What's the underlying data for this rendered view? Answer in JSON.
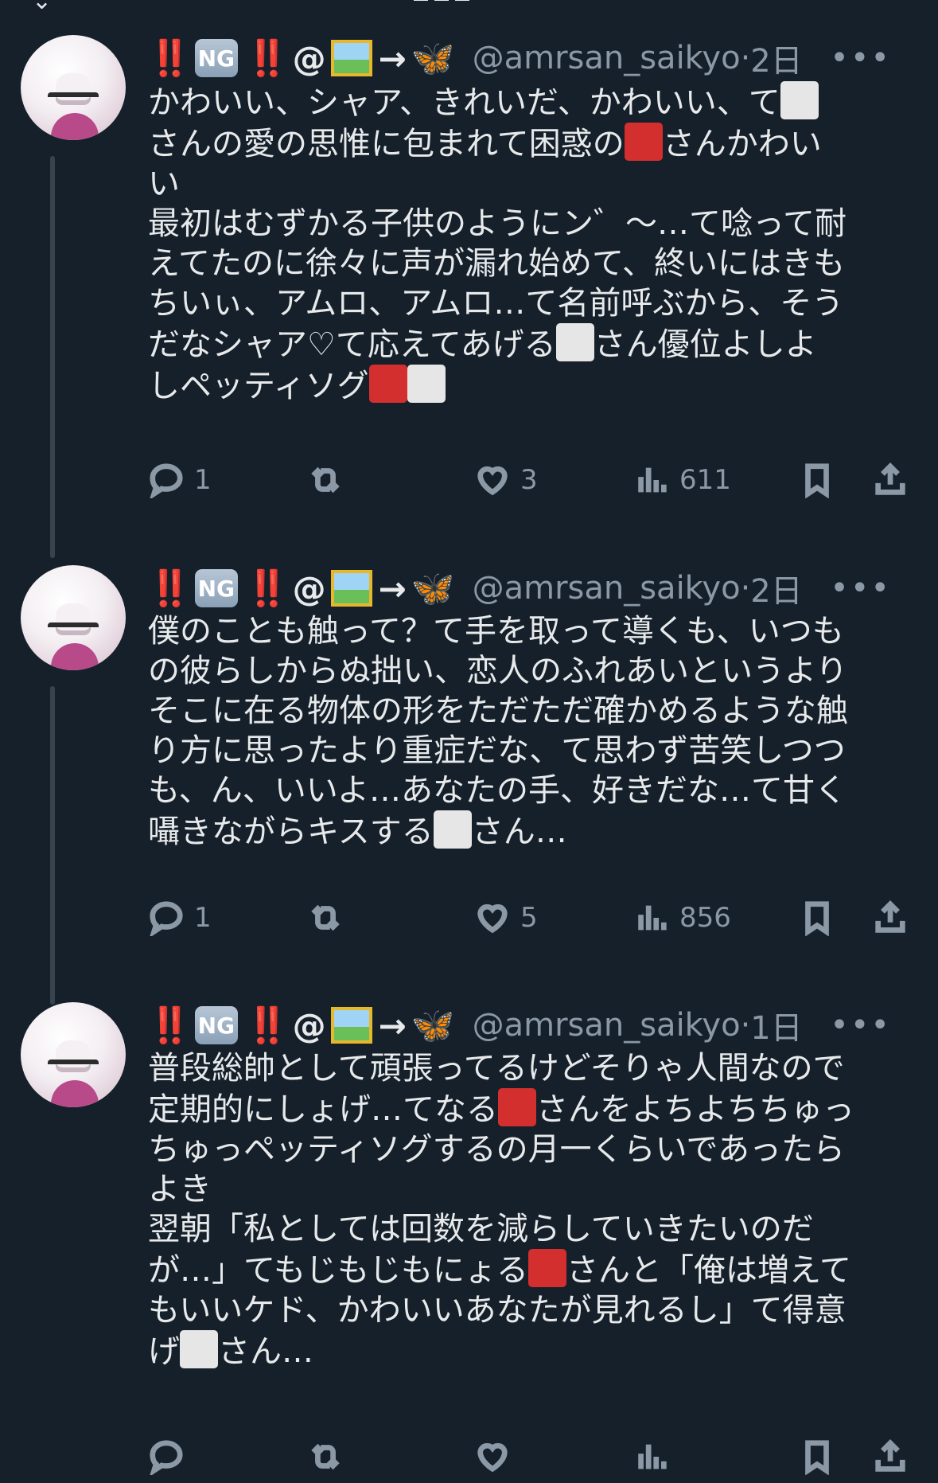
{
  "top": {
    "back_glyph": "⌄"
  },
  "posts": [
    {
      "name_prefix_bang": "‼️",
      "ng_label": "NG",
      "at": "@",
      "arrow": "→",
      "butterfly": "🦋",
      "handle": "@amrsan_saikyo",
      "dot": "·",
      "time": "2日",
      "more": "•••",
      "lines": [
        [
          "かわいい、シャア、きれいだ、かわいい、て",
          "W"
        ],
        [
          "さんの愛の思惟に包まれて困惑の",
          "R",
          "さんかわい"
        ],
        [
          "い"
        ],
        [
          "最初はむずかる子供のようにン゛〜…て唸って耐"
        ],
        [
          "えてたのに徐々に声が漏れ始めて、終いにはきも"
        ],
        [
          "ちいぃ、アムロ、アムロ…て名前呼ぶから、そう"
        ],
        [
          "だなシャア♡て応えてあげる",
          "W",
          "さん優位よしよ"
        ],
        [
          "しペッティソグ",
          "R",
          "W"
        ]
      ],
      "replies": "1",
      "likes": "3",
      "views": "611"
    },
    {
      "name_prefix_bang": "‼️",
      "ng_label": "NG",
      "at": "@",
      "arrow": "→",
      "butterfly": "🦋",
      "handle": "@amrsan_saikyo",
      "dot": "·",
      "time": "2日",
      "more": "•••",
      "lines": [
        [
          "僕のことも触って？て手を取って導くも、いつも"
        ],
        [
          "の彼らしからぬ拙い、恋人のふれあいというより"
        ],
        [
          "そこに在る物体の形をただただ確かめるような触"
        ],
        [
          "り方に思ったより重症だな、て思わず苦笑しつつ"
        ],
        [
          "も、ん、いいよ…あなたの手、好きだな…て甘く"
        ],
        [
          "囁きながらキスする",
          "W",
          "さん…"
        ]
      ],
      "replies": "1",
      "likes": "5",
      "views": "856"
    },
    {
      "name_prefix_bang": "‼️",
      "ng_label": "NG",
      "at": "@",
      "arrow": "→",
      "butterfly": "🦋",
      "handle": "@amrsan_saikyo",
      "dot": "·",
      "time": "1日",
      "more": "•••",
      "lines": [
        [
          "普段総帥として頑張ってるけどそりゃ人間なので"
        ],
        [
          "定期的にしょげ…てなる",
          "R",
          "さんをよちよちちゅっ"
        ],
        [
          "ちゅっペッティソグするの月一くらいであったら"
        ],
        [
          "よき"
        ],
        [
          "翌朝「私としては回数を減らしていきたいのだ"
        ],
        [
          "が…」てもじもじもにょる",
          "R",
          "さんと「俺は増えて"
        ],
        [
          "もいいケド、かわいいあなたが見れるし」て得意"
        ],
        [
          "げ",
          "W",
          "さん…"
        ]
      ],
      "replies": "",
      "likes": "",
      "views": ""
    }
  ],
  "colors": {
    "background": "#15202b",
    "text": "#e7e9ea",
    "muted": "#8b98a5",
    "accent_red": "#d32f2f"
  }
}
